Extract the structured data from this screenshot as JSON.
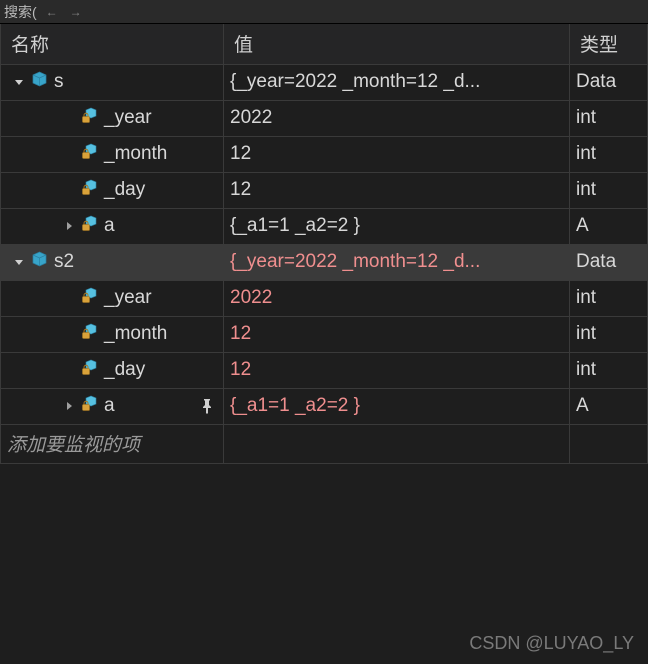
{
  "toolbar": {
    "search_label": "搜索("
  },
  "columns": [
    {
      "label": "名称"
    },
    {
      "label": "值"
    },
    {
      "label": "类型"
    }
  ],
  "rows": [
    {
      "name": "s",
      "value": "{_year=2022 _month=12 _d...",
      "type": "Data",
      "depth": 0,
      "expander": "expanded",
      "icon": "struct",
      "selected": false,
      "changed": false,
      "pinned": false
    },
    {
      "name": "_year",
      "value": "2022",
      "type": "int",
      "depth": 1,
      "expander": "none",
      "icon": "private",
      "selected": false,
      "changed": false,
      "pinned": false
    },
    {
      "name": "_month",
      "value": "12",
      "type": "int",
      "depth": 1,
      "expander": "none",
      "icon": "private",
      "selected": false,
      "changed": false,
      "pinned": false
    },
    {
      "name": "_day",
      "value": "12",
      "type": "int",
      "depth": 1,
      "expander": "none",
      "icon": "private",
      "selected": false,
      "changed": false,
      "pinned": false
    },
    {
      "name": "a",
      "value": "{_a1=1 _a2=2 }",
      "type": "A",
      "depth": 1,
      "expander": "collapsed",
      "icon": "private",
      "selected": false,
      "changed": false,
      "pinned": false
    },
    {
      "name": "s2",
      "value": "{_year=2022 _month=12 _d...",
      "type": "Data",
      "depth": 0,
      "expander": "expanded",
      "icon": "struct",
      "selected": true,
      "changed": true,
      "pinned": false
    },
    {
      "name": "_year",
      "value": "2022",
      "type": "int",
      "depth": 1,
      "expander": "none",
      "icon": "private",
      "selected": false,
      "changed": true,
      "pinned": false
    },
    {
      "name": "_month",
      "value": "12",
      "type": "int",
      "depth": 1,
      "expander": "none",
      "icon": "private",
      "selected": false,
      "changed": true,
      "pinned": false
    },
    {
      "name": "_day",
      "value": "12",
      "type": "int",
      "depth": 1,
      "expander": "none",
      "icon": "private",
      "selected": false,
      "changed": true,
      "pinned": false
    },
    {
      "name": "a",
      "value": "{_a1=1 _a2=2 }",
      "type": "A",
      "depth": 1,
      "expander": "collapsed",
      "icon": "private",
      "selected": false,
      "changed": true,
      "pinned": true
    }
  ],
  "add_watch_placeholder": "添加要监视的项",
  "watermark": "CSDN @LUYAO_LY"
}
